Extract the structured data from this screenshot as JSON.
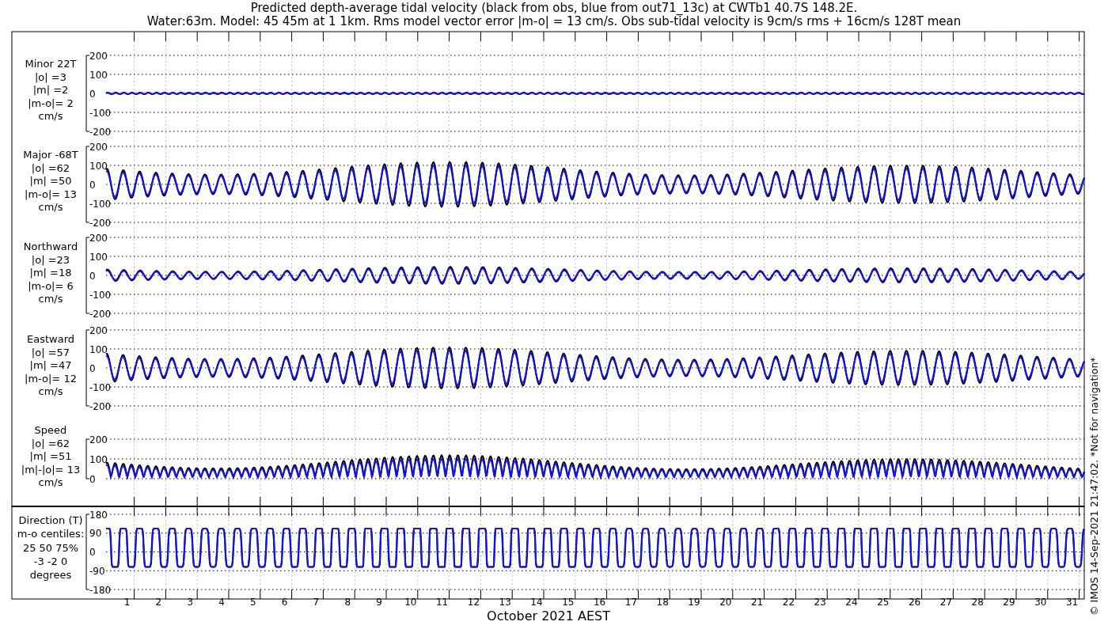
{
  "title_lines": [
    "Predicted depth-average tidal velocity (black from obs, blue from out71_13c) at CWTb1 40.7S 148.2E.",
    "Water:63m. Model: 45 45m at 1 1km. Rms model vector error |m-o| = 13 cm/s. Obs sub-tidal velocity is 9cm/s rms + 16cm/s 128T mean"
  ],
  "panels": [
    {
      "kind": "minor",
      "label_lines": [
        "Minor 22T",
        "|o| =3",
        "|m| =2",
        "|m-o|= 2",
        "cm/s"
      ],
      "yticks": [
        "200",
        "100",
        "0",
        "-100",
        "-200"
      ]
    },
    {
      "kind": "major",
      "label_lines": [
        "Major -68T",
        "|o| =62",
        "|m| =50",
        "|m-o|= 13",
        "cm/s"
      ],
      "yticks": [
        "200",
        "100",
        "0",
        "-100",
        "-200"
      ]
    },
    {
      "kind": "northward",
      "label_lines": [
        "Northward",
        "|o| =23",
        "|m| =18",
        "|m-o|= 6",
        "cm/s"
      ],
      "yticks": [
        "200",
        "100",
        "0",
        "-100",
        "-200"
      ]
    },
    {
      "kind": "eastward",
      "label_lines": [
        "Eastward",
        "|o| =57",
        "|m| =47",
        "|m-o|= 12",
        "cm/s"
      ],
      "yticks": [
        "200",
        "100",
        "0",
        "-100",
        "-200"
      ]
    },
    {
      "kind": "speed",
      "label_lines": [
        "Speed",
        "|o| =62",
        "|m| =51",
        "|m|-|o|= 13",
        "cm/s"
      ],
      "yticks": [
        "200",
        "100",
        "0"
      ]
    },
    {
      "kind": "direction",
      "label_lines": [
        "Direction (T)",
        "m-o centiles:",
        "25  50  75%",
        "-3 -2  0",
        "degrees"
      ],
      "yticks": [
        "180",
        "90",
        "0",
        "-90",
        "-180"
      ]
    }
  ],
  "xticks": [
    "1",
    "2",
    "3",
    "4",
    "5",
    "6",
    "7",
    "8",
    "9",
    "10",
    "11",
    "12",
    "13",
    "14",
    "15",
    "16",
    "17",
    "18",
    "19",
    "20",
    "21",
    "22",
    "23",
    "24",
    "25",
    "26",
    "27",
    "28",
    "29",
    "30",
    "31"
  ],
  "xlabel": "October 2021 AEST",
  "credit": "© IMOS 14-Sep-2021 21:47:02. *Not for navigation*"
}
